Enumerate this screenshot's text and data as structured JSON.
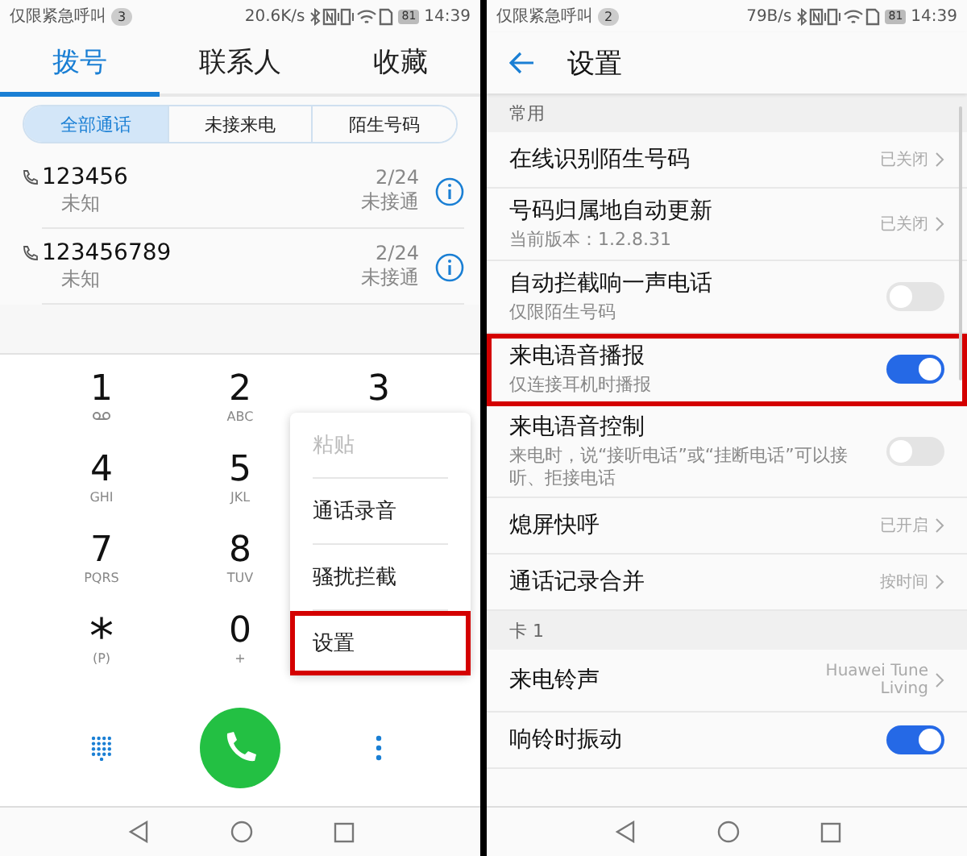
{
  "dialer_screen": {
    "status_bar": {
      "carrier": "仅限紧急呼叫",
      "notification_count": "3",
      "speed": "20.6K/s",
      "battery": "81",
      "time": "14:39"
    },
    "tabs": [
      {
        "label": "拨号",
        "selected": true
      },
      {
        "label": "联系人",
        "selected": false
      },
      {
        "label": "收藏",
        "selected": false
      }
    ],
    "filters": [
      {
        "label": "全部通话",
        "selected": true
      },
      {
        "label": "未接来电",
        "selected": false
      },
      {
        "label": "陌生号码",
        "selected": false
      }
    ],
    "calls": [
      {
        "number": "123456",
        "location": "未知",
        "date": "2/24",
        "status": "未接通"
      },
      {
        "number": "123456789",
        "location": "未知",
        "date": "2/24",
        "status": "未接通"
      }
    ],
    "keypad": [
      [
        {
          "digit": "1",
          "kind": "voicemail"
        },
        {
          "digit": "2",
          "letters": "ABC"
        },
        {
          "digit": "3"
        }
      ],
      [
        {
          "digit": "4",
          "letters": "GHI"
        },
        {
          "digit": "5",
          "letters": "JKL"
        }
      ],
      [
        {
          "digit": "7",
          "letters": "PQRS"
        },
        {
          "digit": "8",
          "letters": "TUV"
        }
      ],
      [
        {
          "digit": "*",
          "letters": "(P)",
          "kind": "star"
        },
        {
          "digit": "0",
          "letters": "+"
        }
      ]
    ],
    "menu": [
      {
        "label": "粘贴",
        "disabled": true,
        "highlighted": false
      },
      {
        "label": "通话录音",
        "disabled": false,
        "highlighted": false
      },
      {
        "label": "骚扰拦截",
        "disabled": false,
        "highlighted": false
      },
      {
        "label": "设置",
        "disabled": false,
        "highlighted": true
      }
    ]
  },
  "settings_screen": {
    "status_bar": {
      "carrier": "仅限紧急呼叫",
      "notification_count": "2",
      "speed": "79B/s",
      "battery": "81",
      "time": "14:39"
    },
    "title": "设置",
    "sections": [
      {
        "title": "常用",
        "rows": [
          {
            "kind": "link",
            "title": "在线识别陌生号码",
            "value": "已关闭",
            "highlighted": false
          },
          {
            "kind": "link",
            "title": "号码归属地自动更新",
            "subtitle": "当前版本：1.2.8.31",
            "value": "已关闭",
            "highlighted": false
          },
          {
            "kind": "toggle",
            "title": "自动拦截响一声电话",
            "subtitle": "仅限陌生号码",
            "on": false,
            "highlighted": false
          },
          {
            "kind": "toggle",
            "title": "来电语音播报",
            "subtitle": "仅连接耳机时播报",
            "on": true,
            "highlighted": true
          },
          {
            "kind": "toggle",
            "title": "来电语音控制",
            "subtitle": "来电时，说“接听电话”或“挂断电话”可以接听、拒接电话",
            "on": false,
            "highlighted": false
          },
          {
            "kind": "link",
            "title": "熄屏快呼",
            "value": "已开启",
            "highlighted": false
          },
          {
            "kind": "link",
            "title": "通话记录合并",
            "value": "按时间",
            "highlighted": false
          }
        ]
      },
      {
        "title": "卡 1",
        "rows": [
          {
            "kind": "link",
            "title": "来电铃声",
            "value": "Huawei Tune Living",
            "highlighted": false
          },
          {
            "kind": "toggle",
            "title": "响铃时振动",
            "on": true,
            "highlighted": false
          }
        ]
      }
    ]
  }
}
